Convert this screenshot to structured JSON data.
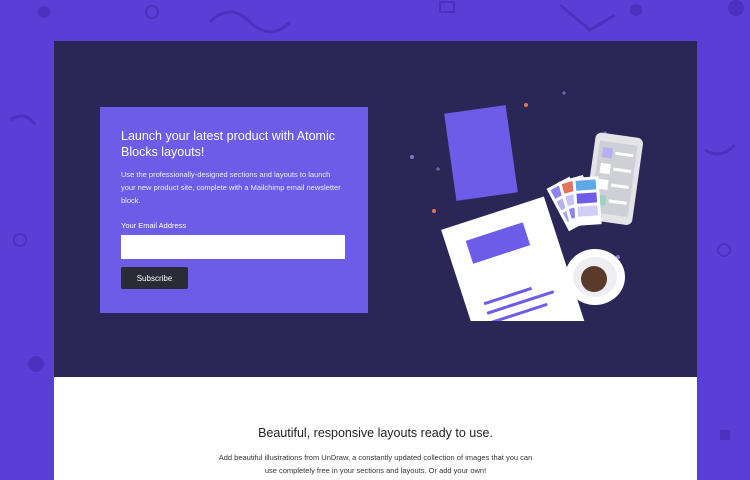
{
  "hero": {
    "title": "Launch your latest product with Atomic Blocks layouts!",
    "description": "Use the professionally-designed sections and layouts to launch your new product site, complete with a Mailchimp email newsletter block.",
    "email_label": "Your Email Address",
    "email_value": "",
    "subscribe_label": "Subscribe"
  },
  "section": {
    "title": "Beautiful, responsive layouts ready to use.",
    "description": "Add beautiful illustrations from UnDraw, a constantly updated collection of images that you can use completely free in your sections and layouts. Or add your own!"
  },
  "colors": {
    "background": "#5a3fd6",
    "hero_background": "#2a2656",
    "card_accent": "#6c5ce7",
    "button": "#2b2b38",
    "content_background": "#ffffff"
  },
  "illustration": {
    "icons": [
      "document-icon",
      "phone-icon",
      "color-swatch-icon",
      "coffee-cup-icon",
      "folder-icon"
    ]
  }
}
